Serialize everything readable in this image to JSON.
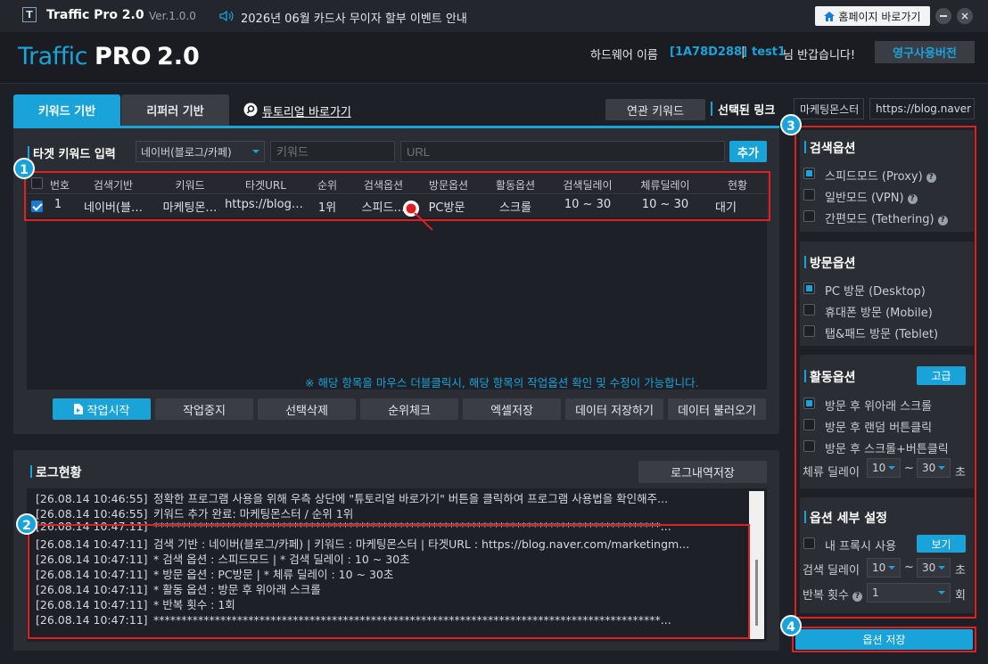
{
  "titlebar": {
    "logo_letter": "T",
    "app_name": "Traffic Pro 2.0",
    "version": "Ver.1.0.0",
    "notice": "2026년 06월 카드사 무이자 할부 이벤트 안내",
    "home_button": "홈페이지 바로가기"
  },
  "brand": {
    "logo_traffic": "Traffic",
    "logo_pro": "PRO",
    "logo_version": "2.0",
    "hw_label": "하드웨어 이름",
    "hw_id": "[1A78D288]",
    "separator": "|",
    "user": "test1",
    "greeting": "님 반갑습니다!",
    "license_button": "영구사용버전"
  },
  "tabs": [
    {
      "label": "키워드 기반",
      "active": true
    },
    {
      "label": "리퍼러 기반",
      "active": false
    }
  ],
  "tutorial_link": "튜토리얼 바로가기",
  "related_keyword_button": "연관 키워드",
  "selected_link": {
    "label": "선택된 링크",
    "keyword": "마케팅몬스터",
    "url": "https://blog.naver"
  },
  "target_input": {
    "title": "타겟 키워드 입력",
    "source_select": "네이버(블로그/카페)",
    "keyword_placeholder": "키워드",
    "url_placeholder": "URL",
    "add_button": "추가"
  },
  "table": {
    "headers": [
      "번호",
      "검색기반",
      "키워드",
      "타겟URL",
      "순위",
      "검색옵션",
      "방문옵션",
      "활동옵션",
      "검색딜레이",
      "체류딜레이",
      "현황"
    ],
    "rows": [
      {
        "checked": true,
        "no": "1",
        "source": "네이버(블…",
        "keyword": "마케팅몬…",
        "url": "https://blog…",
        "rank": "1위",
        "search_opt": "스피드…",
        "visit_opt": "PC방문",
        "activity": "스크롤",
        "search_delay": "10 ~ 30",
        "stay_delay": "10 ~ 30",
        "status": "대기"
      }
    ],
    "hint": "※ 해당 항목을 마우스 더블클릭시, 해당 항목의 작업옵션 확인 및 수정이 가능합니다."
  },
  "actions": [
    "작업시작",
    "작업중지",
    "선택삭제",
    "순위체크",
    "엑셀저장",
    "데이터 저장하기",
    "데이터 불러오기"
  ],
  "log": {
    "title": "로그현황",
    "save_button": "로그내역저장",
    "lines": [
      {
        "time": "[26.08.14 10:46:55]",
        "text": "정확한 프로그램 사용을 위해 우측 상단에 \"튜토리얼 바로가기\" 버튼을 클릭하여 프로그램 사용법을 확인해주..."
      },
      {
        "time": "[26.08.14 10:46:55]",
        "text": "키워드 추가 완료: 마케팅몬스터 / 순위 1위"
      },
      {
        "time": "[26.08.14 10:47:11]",
        "text": "*******************************************************************************************..."
      },
      {
        "time": "[26.08.14 10:47:11]",
        "text": "검색 기반 : 네이버(블로그/카페) | 키워드 : 마케팅몬스터 | 타겟URL : https://blog.naver.com/marketingm..."
      },
      {
        "time": "[26.08.14 10:47:11]",
        "text": "* 검색 옵션 : 스피드모드 | * 검색 딜레이 : 10 ~ 30초"
      },
      {
        "time": "[26.08.14 10:47:11]",
        "text": "* 방문 옵션 : PC방문 | * 체류 딜레이 : 10 ~ 30초"
      },
      {
        "time": "[26.08.14 10:47:11]",
        "text": "* 활동 옵션 : 방문 후 위아래 스크롤"
      },
      {
        "time": "[26.08.14 10:47:11]",
        "text": "* 반복 횟수 : 1회"
      },
      {
        "time": "[26.08.14 10:47:11]",
        "text": "*******************************************************************************************..."
      }
    ]
  },
  "options": {
    "search": {
      "title": "검색옵션",
      "items": [
        {
          "label": "스피드모드 (Proxy)",
          "checked": true,
          "help": "?"
        },
        {
          "label": "일반모드 (VPN)",
          "checked": false,
          "help": "?"
        },
        {
          "label": "간편모드 (Tethering)",
          "checked": false,
          "help": "?"
        }
      ]
    },
    "visit": {
      "title": "방문옵션",
      "items": [
        {
          "label": "PC 방문 (Desktop)",
          "checked": true
        },
        {
          "label": "휴대폰 방문 (Mobile)",
          "checked": false
        },
        {
          "label": "탭&패드 방문 (Teblet)",
          "checked": false
        }
      ]
    },
    "activity": {
      "title": "활동옵션",
      "advanced_button": "고급",
      "items": [
        {
          "label": "방문 후 위아래 스크롤",
          "checked": true
        },
        {
          "label": "방문 후 랜덤 버튼클릭",
          "checked": false
        },
        {
          "label": "방문 후 스크롤+버튼클릭",
          "checked": false
        }
      ],
      "stay_label": "체류 딜레이",
      "stay_from": "10",
      "tilde": "~",
      "stay_to": "30",
      "unit_sec": "초"
    },
    "detail": {
      "title": "옵션 세부 설정",
      "proxy_label": "내 프록시 사용",
      "view_button": "보기",
      "search_delay_label": "검색 딜레이",
      "search_from": "10",
      "tilde": "~",
      "search_to": "30",
      "unit_sec": "초",
      "repeat_label": "반복 횟수",
      "repeat_help": "?",
      "repeat_value": "1",
      "unit_times": "회"
    },
    "save_button": "옵션 저장"
  },
  "badges": [
    "1",
    "2",
    "3",
    "4"
  ],
  "colors": {
    "accent": "#1aa3d9",
    "highlight": "#e02020",
    "background": "#1d2026",
    "panel": "#2a2d33"
  }
}
